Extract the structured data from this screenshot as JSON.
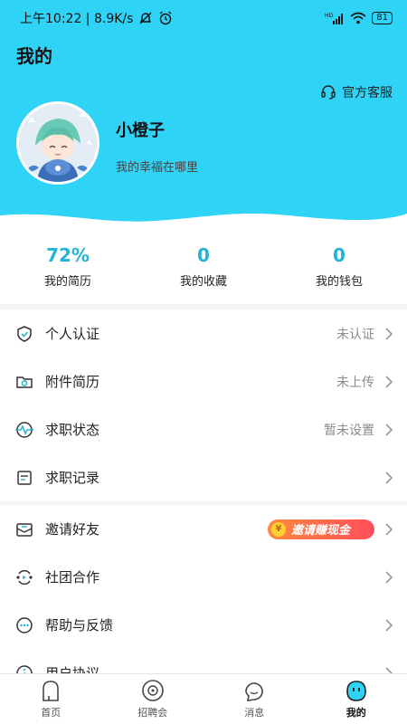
{
  "status_bar": {
    "time_speed": "上午10:22 | 8.9K/s",
    "battery": "81",
    "icons": [
      "mute-icon",
      "alarm-icon",
      "signal-icon",
      "wifi-icon",
      "battery-icon"
    ]
  },
  "page_title": "我的",
  "service": {
    "label": "官方客服",
    "icon": "headset-icon"
  },
  "profile": {
    "name": "小橙子",
    "motto": "我的幸福在哪里"
  },
  "stats": [
    {
      "value": "72%",
      "label": "我的简历"
    },
    {
      "value": "0",
      "label": "我的收藏"
    },
    {
      "value": "0",
      "label": "我的钱包"
    }
  ],
  "menu1": [
    {
      "label": "个人认证",
      "status": "未认证",
      "icon": "shield-check-icon"
    },
    {
      "label": "附件简历",
      "status": "未上传",
      "icon": "folder-icon"
    },
    {
      "label": "求职状态",
      "status": "暂未设置",
      "icon": "pulse-icon"
    },
    {
      "label": "求职记录",
      "status": "",
      "icon": "record-icon"
    }
  ],
  "menu2": [
    {
      "label": "邀请好友",
      "badge": "邀请赚现金",
      "coin": "¥",
      "icon": "envelope-icon"
    },
    {
      "label": "社团合作",
      "icon": "cooperation-icon"
    },
    {
      "label": "帮助与反馈",
      "icon": "chat-dots-icon"
    },
    {
      "label": "用户协议",
      "icon": "info-icon"
    }
  ],
  "tabbar": [
    {
      "label": "首页",
      "icon": "home-icon"
    },
    {
      "label": "招聘会",
      "icon": "disc-icon"
    },
    {
      "label": "消息",
      "icon": "message-icon"
    },
    {
      "label": "我的",
      "icon": "mine-icon"
    }
  ],
  "colors": {
    "header": "#2fd3f6",
    "accent": "#23b3d6",
    "badge_start": "#ff8a3c",
    "badge_end": "#ff4d5b"
  }
}
